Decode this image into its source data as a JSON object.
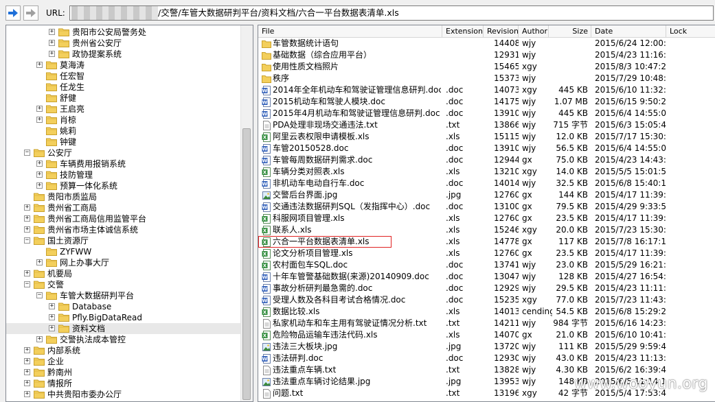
{
  "toolbar": {
    "url_label": "URL:",
    "url_path": "/交警/车管大数据研判平台/资料文档/六合一平台数据表清单.xls",
    "colors": {
      "back_arrow": "#1e6fd8",
      "forward_arrow": "#a0a0a0"
    }
  },
  "tree": {
    "items": [
      {
        "label": "贵阳市公安局警务处",
        "level": 3,
        "expand": "+"
      },
      {
        "label": "贵州省公安厅",
        "level": 3,
        "expand": "+"
      },
      {
        "label": "政协提案系统",
        "level": 3,
        "expand": "+"
      },
      {
        "label": "莫海涛",
        "level": 2,
        "expand": "+"
      },
      {
        "label": "任宏智",
        "level": 2,
        "expand": ""
      },
      {
        "label": "任龙生",
        "level": 2,
        "expand": ""
      },
      {
        "label": "舒健",
        "level": 2,
        "expand": ""
      },
      {
        "label": "王启亮",
        "level": 2,
        "expand": "+"
      },
      {
        "label": "肖椋",
        "level": 2,
        "expand": "+"
      },
      {
        "label": "姚莉",
        "level": 2,
        "expand": ""
      },
      {
        "label": "钟键",
        "level": 2,
        "expand": ""
      },
      {
        "label": "公安厅",
        "level": 1,
        "expand": "-"
      },
      {
        "label": "车辆费用报销系统",
        "level": 2,
        "expand": "+"
      },
      {
        "label": "技防管理",
        "level": 2,
        "expand": "+"
      },
      {
        "label": "预算一体化系统",
        "level": 2,
        "expand": "+"
      },
      {
        "label": "贵阳市质监局",
        "level": 1,
        "expand": ""
      },
      {
        "label": "贵州省工商局",
        "level": 1,
        "expand": "+"
      },
      {
        "label": "贵州省工商局信用监管平台",
        "level": 1,
        "expand": "+"
      },
      {
        "label": "贵州省市场主体诚信系统",
        "level": 1,
        "expand": "+"
      },
      {
        "label": "国土资源厅",
        "level": 1,
        "expand": "-"
      },
      {
        "label": "ZYFWW",
        "level": 2,
        "expand": ""
      },
      {
        "label": "网上办事大厅",
        "level": 2,
        "expand": "+"
      },
      {
        "label": "机要局",
        "level": 1,
        "expand": "+"
      },
      {
        "label": "交警",
        "level": 1,
        "expand": "-"
      },
      {
        "label": "车管大数据研判平台",
        "level": 2,
        "expand": "-"
      },
      {
        "label": "Database",
        "level": 3,
        "expand": "+"
      },
      {
        "label": "Pfly.BigDataRead",
        "level": 3,
        "expand": "+"
      },
      {
        "label": "资料文档",
        "level": 3,
        "expand": "+",
        "selected": true
      },
      {
        "label": "交警执法成本管控",
        "level": 2,
        "expand": "+"
      },
      {
        "label": "内部系统",
        "level": 1,
        "expand": "+"
      },
      {
        "label": "企业",
        "level": 1,
        "expand": "+"
      },
      {
        "label": "黔南州",
        "level": 1,
        "expand": "+"
      },
      {
        "label": "情报所",
        "level": 1,
        "expand": "+"
      },
      {
        "label": "中共贵阳市委办公厅",
        "level": 1,
        "expand": "+"
      }
    ]
  },
  "list": {
    "columns": [
      "File",
      "Extension",
      "Revision",
      "Author",
      "Size",
      "Date",
      "Lock"
    ],
    "rows": [
      {
        "icon": "folder",
        "name": "车管数据统计语句",
        "ext": "",
        "rev": "14408",
        "author": "wjy",
        "size": "",
        "date": "2015/6/24 12:00:16"
      },
      {
        "icon": "folder",
        "name": "基础数据（综合应用平台）",
        "ext": "",
        "rev": "12931",
        "author": "wjy",
        "size": "",
        "date": "2015/4/23 11:16:15"
      },
      {
        "icon": "folder",
        "name": "使用性质文档照片",
        "ext": "",
        "rev": "15465",
        "author": "xgy",
        "size": "",
        "date": "2015/8/3 10:47:28"
      },
      {
        "icon": "folder",
        "name": "秩序",
        "ext": "",
        "rev": "15373",
        "author": "wjy",
        "size": "",
        "date": "2015/7/29 10:48:22"
      },
      {
        "icon": "doc",
        "name": "2014年全年机动车和驾驶证管理信息研判.doc",
        "ext": ".doc",
        "rev": "14073",
        "author": "xgy",
        "size": "445 KB",
        "date": "2015/6/10 11:32:26"
      },
      {
        "icon": "doc",
        "name": "2015机动车和驾驶人模块.doc",
        "ext": ".doc",
        "rev": "14175",
        "author": "wjy",
        "size": "1.07 MB",
        "date": "2015/6/15 9:50:28"
      },
      {
        "icon": "doc",
        "name": "2015年4月机动车和驾驶证管理信息研判.doc",
        "ext": ".doc",
        "rev": "13910",
        "author": "wjy",
        "size": "445 KB",
        "date": "2015/6/4 14:55:06"
      },
      {
        "icon": "txt",
        "name": "PDA处理非现场交通违法.txt",
        "ext": ".txt",
        "rev": "13866",
        "author": "wjy",
        "size": "715 字节",
        "date": "2015/6/3 15:05:46"
      },
      {
        "icon": "xls",
        "name": "阿里云表权限申请模板.xls",
        "ext": ".xls",
        "rev": "15115",
        "author": "wjy",
        "size": "12.0 KB",
        "date": "2015/7/17 15:30:59"
      },
      {
        "icon": "doc",
        "name": "车管20150528.doc",
        "ext": ".doc",
        "rev": "13910",
        "author": "wjy",
        "size": "56.5 KB",
        "date": "2015/6/4 14:55:06"
      },
      {
        "icon": "doc",
        "name": "车管每周数据研判需求.doc",
        "ext": ".doc",
        "rev": "12944",
        "author": "gx",
        "size": "75.0 KB",
        "date": "2015/4/23 14:43:52"
      },
      {
        "icon": "xls",
        "name": "车辆分类对照表.xls",
        "ext": ".xls",
        "rev": "13210",
        "author": "xgy",
        "size": "14.0 KB",
        "date": "2015/5/5 15:01:50"
      },
      {
        "icon": "doc",
        "name": "非机动车电动自行车.doc",
        "ext": ".doc",
        "rev": "14014",
        "author": "wjy",
        "size": "32.5 KB",
        "date": "2015/6/8 15:40:16"
      },
      {
        "icon": "jpg",
        "name": "交警后台界面.jpg",
        "ext": ".jpg",
        "rev": "12760",
        "author": "gx",
        "size": "144 KB",
        "date": "2015/4/17 11:39:11"
      },
      {
        "icon": "doc",
        "name": "交通违法数据研判SQL（发指挥中心）.doc",
        "ext": ".doc",
        "rev": "13100",
        "author": "gx",
        "size": "79.5 KB",
        "date": "2015/4/29 9:33:52"
      },
      {
        "icon": "xls",
        "name": "科服网项目管理.xls",
        "ext": ".xls",
        "rev": "12760",
        "author": "gx",
        "size": "23.5 KB",
        "date": "2015/4/17 11:39:11"
      },
      {
        "icon": "xls",
        "name": "联系人.xls",
        "ext": ".xls",
        "rev": "15246",
        "author": "xgy",
        "size": "20.0 KB",
        "date": "2015/7/23 15:30:40"
      },
      {
        "icon": "xls",
        "name": "六合一平台数据表清单.xls",
        "ext": ".xls",
        "rev": "14778",
        "author": "gx",
        "size": "117 KB",
        "date": "2015/7/8 16:17:16",
        "highlight": true
      },
      {
        "icon": "xls",
        "name": "论文分析项目管理.xls",
        "ext": ".xls",
        "rev": "12760",
        "author": "gx",
        "size": "23.5 KB",
        "date": "2015/4/17 11:39:11"
      },
      {
        "icon": "xls",
        "name": "农村面包车SQL.doc",
        "ext": ".doc",
        "rev": "13741",
        "author": "wjy",
        "size": "23.0 KB",
        "date": "2015/5/29 16:21:03"
      },
      {
        "icon": "doc",
        "name": "十年车管警基础数据(来源)20140909.doc",
        "ext": ".doc",
        "rev": "13047",
        "author": "wjy",
        "size": "128 KB",
        "date": "2015/4/27 16:54:44"
      },
      {
        "icon": "doc",
        "name": "事故分析研判最急需的.doc",
        "ext": ".doc",
        "rev": "12929",
        "author": "wjy",
        "size": "29.5 KB",
        "date": "2015/4/23 11:11:59"
      },
      {
        "icon": "doc",
        "name": "受理人数及各科目考试合格情况.doc",
        "ext": ".doc",
        "rev": "15235",
        "author": "xgy",
        "size": "77.0 KB",
        "date": "2015/7/23 11:43:17"
      },
      {
        "icon": "xls",
        "name": "数据比较.xls",
        "ext": ".xls",
        "rev": "14013",
        "author": "cending",
        "size": "54.5 KB",
        "date": "2015/6/8 15:29:28"
      },
      {
        "icon": "txt",
        "name": "私家机动车和车主用有驾驶证情况分析.txt",
        "ext": ".txt",
        "rev": "14211",
        "author": "wjy",
        "size": "984 字节",
        "date": "2015/6/16 14:23:51"
      },
      {
        "icon": "xls",
        "name": "危险物品运输车违法代码.xls",
        "ext": ".xls",
        "rev": "14070",
        "author": "gx",
        "size": "21.0 KB",
        "date": "2015/6/10 10:41:35"
      },
      {
        "icon": "jpg",
        "name": "违法三大板块.jpg",
        "ext": ".jpg",
        "rev": "13720",
        "author": "wjy",
        "size": "111 KB",
        "date": "2015/5/29 9:59:47"
      },
      {
        "icon": "doc",
        "name": "违法研判.doc",
        "ext": ".doc",
        "rev": "12930",
        "author": "wjy",
        "size": "43.0 KB",
        "date": "2015/4/23 11:13:09"
      },
      {
        "icon": "txt",
        "name": "违法重点车辆.txt",
        "ext": ".txt",
        "rev": "13828",
        "author": "wjy",
        "size": "4.30 KB",
        "date": "2015/6/2 16:39:44"
      },
      {
        "icon": "jpg",
        "name": "违法重点车辆讨论结果.jpg",
        "ext": ".jpg",
        "rev": "13953",
        "author": "wjy",
        "size": "148 KB",
        "date": "2015/6/5 11:14:11"
      },
      {
        "icon": "txt",
        "name": "问题.txt",
        "ext": ".txt",
        "rev": "13196",
        "author": "xgy",
        "size": "42 字节",
        "date": "2015/5/4 17:53:46"
      }
    ]
  },
  "watermark": "www.wooyun.org"
}
